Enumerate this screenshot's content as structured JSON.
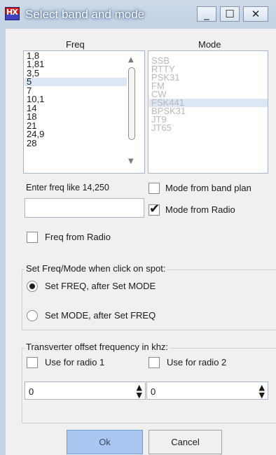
{
  "window": {
    "title": "Select band and mode",
    "icon": "app-flag-icon"
  },
  "window_controls": {
    "minimize": "_",
    "maximize": "☐",
    "close": "✕"
  },
  "headers": {
    "freq": "Freq",
    "mode": "Mode"
  },
  "freq_list": {
    "items": [
      "1,8",
      "1,81",
      "3,5",
      "5",
      "7",
      "10,1",
      "14",
      "18",
      "21",
      "24,9",
      "28"
    ],
    "selected": "3,5"
  },
  "mode_list": {
    "items": [
      "SSB",
      "RTTY",
      "PSK31",
      "FM",
      "CW",
      "FSK441",
      "BPSK31",
      "JT9",
      "JT65"
    ],
    "selected": "CW"
  },
  "freq_entry": {
    "label": "Enter freq like 14,250",
    "value": ""
  },
  "checkboxes": {
    "mode_from_band_plan": {
      "label": "Mode from band plan",
      "checked": false
    },
    "mode_from_radio": {
      "label": "Mode from Radio",
      "checked": true
    },
    "freq_from_radio": {
      "label": "Freq from Radio",
      "checked": false
    }
  },
  "spot_group": {
    "caption": "Set Freq/Mode when click on spot:",
    "options": [
      {
        "label": "Set FREQ, after Set MODE",
        "selected": true
      },
      {
        "label": "Set MODE,  after Set FREQ",
        "selected": false
      }
    ]
  },
  "transverter_group": {
    "caption": "Transverter offset frequency in khz:",
    "use_radio1": {
      "label": "Use for radio 1",
      "checked": false
    },
    "use_radio2": {
      "label": "Use for radio 2",
      "checked": false
    },
    "offset1": "0",
    "offset2": "0"
  },
  "buttons": {
    "ok": "Ok",
    "cancel": "Cancel"
  },
  "colors": {
    "ok_button": "#a7c7f1",
    "selection": "#dde6f4",
    "titlebar": "#c8d5e8"
  }
}
